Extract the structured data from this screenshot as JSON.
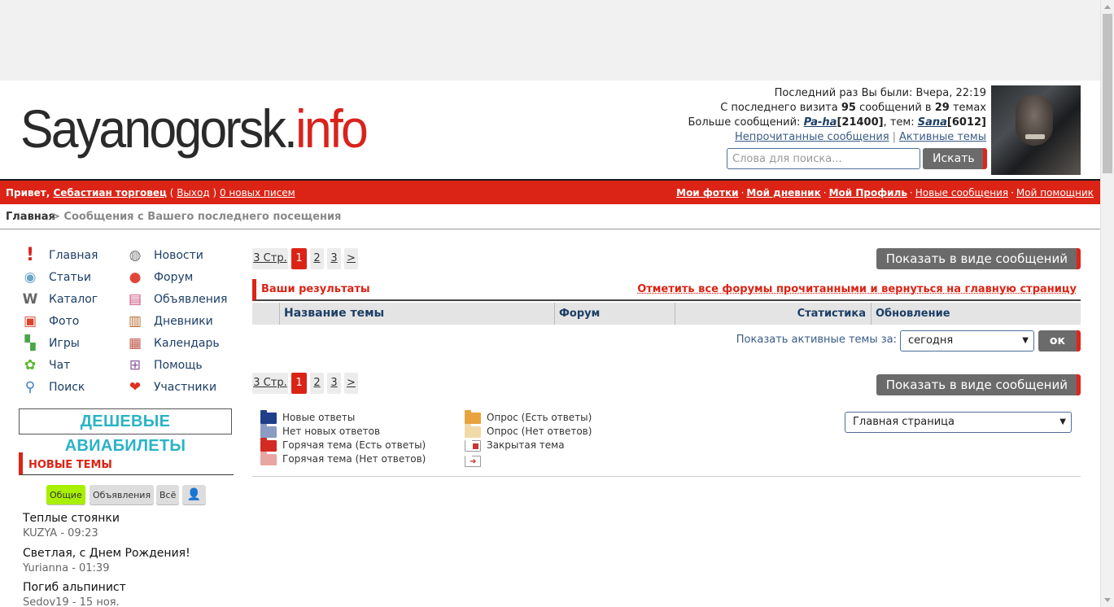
{
  "logo": {
    "part1": "Sayanogorsk.",
    "part2": "info"
  },
  "userinfo": {
    "line1": "Последний раз Вы были: Вчера, 22:19",
    "line2_pre": "С последнего визита ",
    "line2_count": "95",
    "line2_mid": " сообщений в ",
    "line2_topics": "29",
    "line2_post": " темах",
    "line3_pre": "Больше сообщений: ",
    "line3_user1": "Pa-ha",
    "line3_count1": "[21400]",
    "line3_mid": ", тем: ",
    "line3_user2": "Sana",
    "line3_count2": "[6012]",
    "link_unread": "Непрочитанные сообщения",
    "link_sep": "|",
    "link_active": "Активные темы"
  },
  "search": {
    "placeholder": "Слова для поиска...",
    "button": "Искать"
  },
  "redbar": {
    "greet": "Привет, ",
    "username": "Себастиан торговец",
    "paren_open": " ( ",
    "logout": "Выход",
    "paren_close": " ) ",
    "mail": "0 новых писем",
    "links": [
      "Мои фотки",
      "Мой дневник",
      "Мой Профиль",
      "Новые сообщения",
      "Мой помощник"
    ],
    "dot": "·"
  },
  "breadcrumb": {
    "home": "Главная",
    "rest": "> Сообщения с Вашего последнего посещения"
  },
  "nav": {
    "col1": [
      "Главная",
      "Статьи",
      "Каталог",
      "Фото",
      "Игры",
      "Чат",
      "Поиск"
    ],
    "col2": [
      "Новости",
      "Форум",
      "Объявления",
      "Дневники",
      "Календарь",
      "Помощь",
      "Участники"
    ],
    "icons1": [
      "exclamation-icon",
      "satellite-dish-icon",
      "catalog-icon",
      "photo-album-icon",
      "puzzle-icon",
      "chat-flower-icon",
      "magnifier-icon"
    ],
    "icons2": [
      "news-satellite-icon",
      "forum-bubble-icon",
      "ads-box-icon",
      "diary-notebook-icon",
      "calendar-icon",
      "first-aid-kit-icon",
      "members-icon"
    ]
  },
  "banner": "ДЕШЕВЫЕ АВИАБИЛЕТЫ",
  "newtopics": {
    "title": "НОВЫЕ ТЕМЫ",
    "tabs": [
      "Общие",
      "Объявления",
      "Всё"
    ],
    "items": [
      {
        "title": "Теплые стоянки",
        "meta": "KUZYA - 09:23"
      },
      {
        "title": "Светлая, с Днем Рождения!",
        "meta": "Yurianna - 01:39"
      },
      {
        "title": "Погиб альпинист",
        "meta": "Sedov19 - 15 ноя."
      }
    ]
  },
  "pager": {
    "label": "3 Стр.",
    "pages": [
      "1",
      "2",
      "3"
    ],
    "next": ">"
  },
  "show_as_posts": "Показать в виде сообщений",
  "results": {
    "title": "Ваши результаты",
    "markall": "Отметить все форумы прочитанными и вернуться на главную страницу"
  },
  "table_headers": {
    "topic": "Название темы",
    "forum": "Форум",
    "stats": "Статистика",
    "updated": "Обновление"
  },
  "active": {
    "label": "Показать активные темы за:",
    "value": "сегодня",
    "ok": "ок"
  },
  "legend": {
    "col1": [
      "Новые ответы",
      "Нет новых ответов",
      "Горячая тема (Есть ответы)",
      "Горячая тема (Нет ответов)"
    ],
    "col2": [
      "Опрос (Есть ответы)",
      "Опрос (Нет ответов)",
      "Закрытая тема"
    ]
  },
  "forum_jump": "Главная страница",
  "colors": {
    "accent": "#db2416",
    "link": "#1c3e66",
    "button": "#6b6b6b",
    "tab_active": "#a8f000"
  }
}
